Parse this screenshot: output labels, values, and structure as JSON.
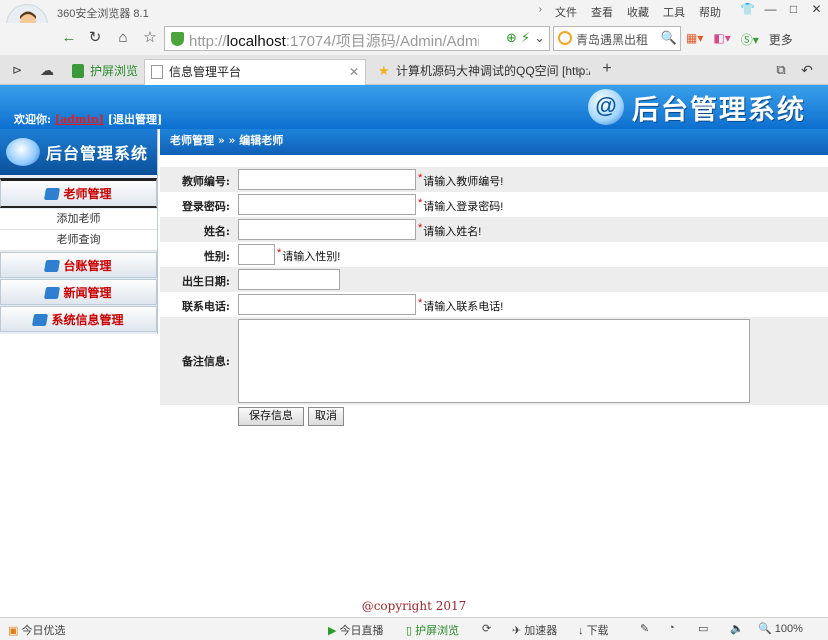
{
  "browser": {
    "app_title": "360安全浏览器 8.1",
    "menu": [
      "文件",
      "查看",
      "收藏",
      "工具",
      "帮助"
    ],
    "url_prefix": "http://",
    "url_host": "localhost",
    "url_rest": ":17074/项目源码/Admin/Admin/...",
    "search_text": "青岛遇黑出租",
    "more_label": "更多",
    "tabs": {
      "green_tab": "护屏浏览",
      "active_tab": "信息管理平台",
      "qq_tab": "计算机源码大神调试的QQ空间 [http:/"
    }
  },
  "header": {
    "welcome_label": "欢迎你:",
    "user": "[admin]",
    "logout_label": "[退出管理]",
    "system_title": "后台管理系统"
  },
  "sidebar": {
    "title": "后台管理系统",
    "groups": {
      "teacher": "老师管理",
      "ledger": "台账管理",
      "news": "新闻管理",
      "sysinfo": "系统信息管理"
    },
    "teacher_items": {
      "add": "添加老师",
      "query": "老师查询"
    }
  },
  "breadcrumb": "老师管理 » » 编辑老师",
  "form": {
    "teacher_no": {
      "label": "教师编号:",
      "hint": "请输入教师编号!"
    },
    "password": {
      "label": "登录密码:",
      "hint": "请输入登录密码!"
    },
    "name": {
      "label": "姓名:",
      "hint": "请输入姓名!"
    },
    "gender": {
      "label": "性别:",
      "hint": "请输入性别!"
    },
    "birth": {
      "label": "出生日期:"
    },
    "phone": {
      "label": "联系电话:",
      "hint": "请输入联系电话!"
    },
    "remark": {
      "label": "备注信息:"
    },
    "star": "*",
    "save_label": "保存信息",
    "cancel_label": "取消"
  },
  "footer": {
    "copyright": "@copyright 2017"
  },
  "statusbar": {
    "left": "今日优选",
    "live": "今日直播",
    "protect": "护屏浏览",
    "speed": "加速器",
    "download": "下载",
    "zoom": "100%"
  }
}
